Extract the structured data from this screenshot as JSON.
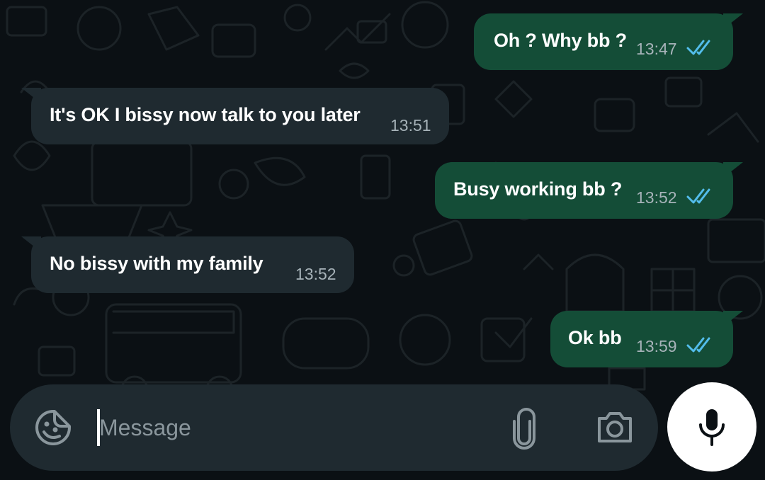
{
  "messages": [
    {
      "direction": "outgoing",
      "text": "Oh ? Why bb ?",
      "time": "13:47",
      "status": "read"
    },
    {
      "direction": "incoming",
      "text": "It's OK I bissy now talk to you later",
      "time": "13:51"
    },
    {
      "direction": "outgoing",
      "text": "Busy working bb ?",
      "time": "13:52",
      "status": "read"
    },
    {
      "direction": "incoming",
      "text": "No bissy with my family",
      "time": "13:52"
    },
    {
      "direction": "outgoing",
      "text": "Ok bb",
      "time": "13:59",
      "status": "read"
    }
  ],
  "composer": {
    "placeholder": "Message",
    "value": "",
    "emoji_icon": "sticker-emoji-icon",
    "attach_icon": "paperclip-icon",
    "camera_icon": "camera-icon",
    "send_icon": "microphone-icon"
  },
  "colors": {
    "background": "#0b1014",
    "outgoing_bubble": "#144d37",
    "incoming_bubble": "#1f2a30",
    "read_ticks": "#53bdeb",
    "timestamp": "#a7b3b9",
    "composer": "#1f2a30"
  }
}
